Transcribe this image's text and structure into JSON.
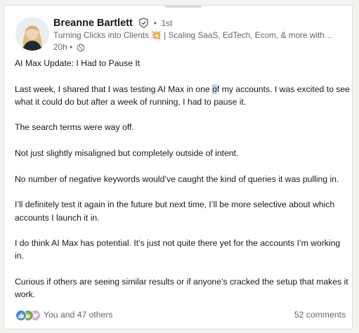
{
  "post": {
    "author": {
      "name": "Breanne Bartlett",
      "connection_degree": "1st",
      "degree_separator": "•",
      "headline": "Turning Clicks into Clients 💥 | Scaling SaaS, EdTech, Ecom, & more with Go…",
      "time_ago": "20h",
      "time_separator": "•"
    },
    "paragraphs": [
      "AI Max Update: I Had to Pause It"
    ],
    "p2_before": "Last week, I shared that I was testing AI Max in one ",
    "p2_highlight": "o",
    "p2_after": "f my accounts. I was excited to see what it could do but after a week of running, I had to pause it.",
    "p3": "The search terms were way off.",
    "p4": "Not just slightly misaligned but completely outside of intent.",
    "p5": "No number of negative keywords would’ve caught the kind of queries it was pulling in.",
    "p6": "I’ll definitely test it again in the future but next time, I’ll be more selective about which accounts I launch it in.",
    "p7": "I do think AI Max has potential. It’s just not quite there yet for the accounts I’m working in.",
    "p8": "Curious if others are seeing similar results or if anyone’s cracked the setup that makes it work.",
    "reactions_text": "You and 47 others",
    "comments_text": "52 comments"
  },
  "icons": {
    "verified": "shield-check-icon",
    "globe": "globe-icon",
    "reaction_like": "thumbs-up-icon",
    "reaction_celebrate": "clapping-hands-icon",
    "reaction_support": "heart-hand-icon"
  },
  "colors": {
    "text_primary": "#191919",
    "text_secondary": "#666666",
    "like_blue": "#378fe9",
    "celebrate_green": "#6dae4f",
    "support_purple": "#d7a9e2",
    "selection_highlight": "#bcd4f6"
  }
}
